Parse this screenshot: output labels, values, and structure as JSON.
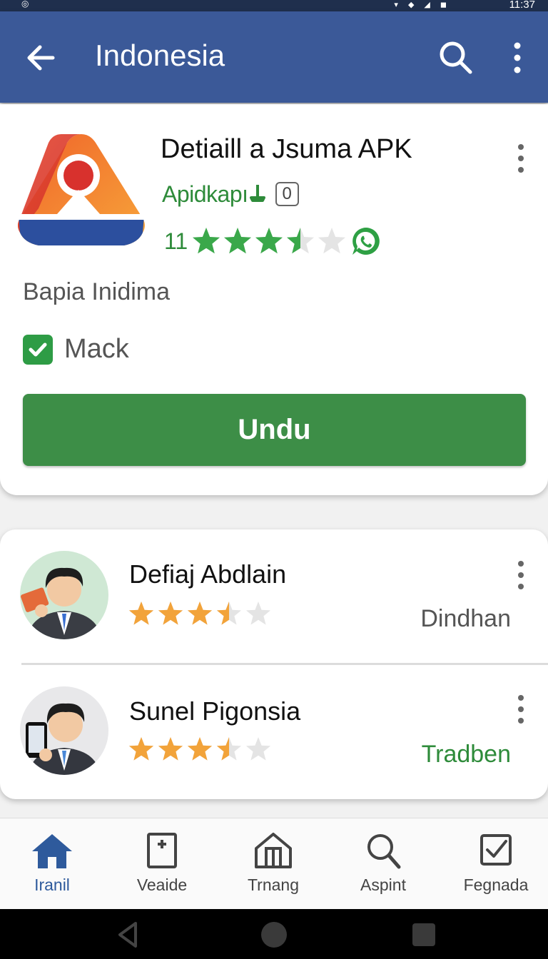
{
  "status_bar": {
    "time": "11:37"
  },
  "app_bar": {
    "title": "Indonesia"
  },
  "app": {
    "name": "Detiaill a Jsuma APK",
    "developer": "Apidkapı",
    "developer_badge": "0",
    "rating_count": "11",
    "rating": 3.5,
    "subtitle": "Bapia Inidima",
    "checkbox_label": "Mack",
    "checkbox_checked": true,
    "download_label": "Undu"
  },
  "list": {
    "items": [
      {
        "name": "Defiaj Abdlain",
        "rating": 3.5,
        "tag": "Dindhan",
        "tag_color": "#555555"
      },
      {
        "name": "Sunel Pigonsia",
        "rating": 3.5,
        "tag": "Tradben",
        "tag_color": "#2e8b3a"
      }
    ]
  },
  "bottom_nav": {
    "items": [
      {
        "label": "Iranil",
        "icon": "home-icon",
        "active": true
      },
      {
        "label": "Veaide",
        "icon": "document-icon",
        "active": false
      },
      {
        "label": "Trnang",
        "icon": "store-icon",
        "active": false
      },
      {
        "label": "Aspint",
        "icon": "search-icon",
        "active": false
      },
      {
        "label": "Fegnada",
        "icon": "checkbox-icon",
        "active": false
      }
    ]
  },
  "colors": {
    "app_bar": "#3b5998",
    "accent_green": "#3d8e47",
    "star_green": "#3aa84a",
    "star_orange": "#f2a33a"
  }
}
